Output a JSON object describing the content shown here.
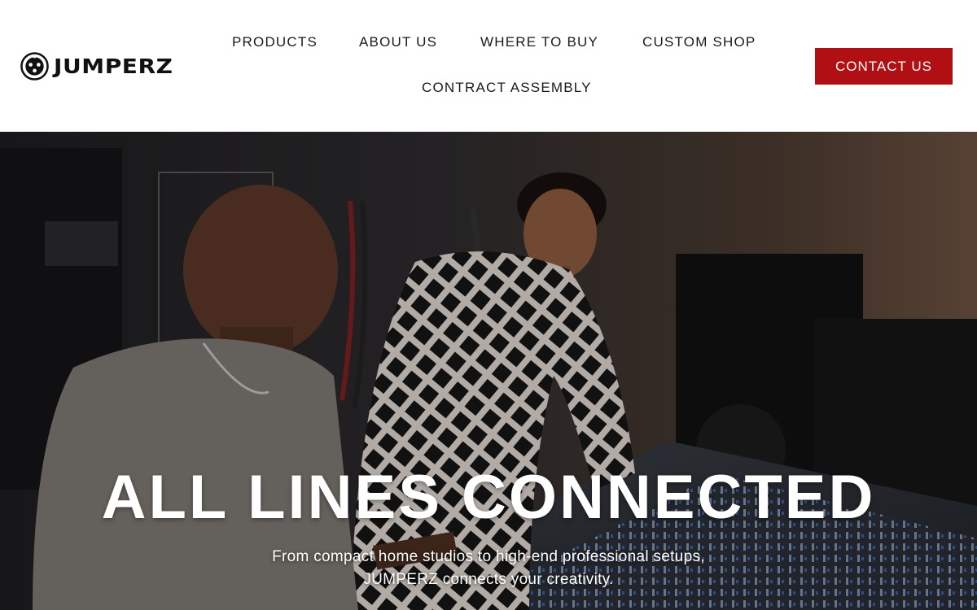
{
  "brand": {
    "name": "JUMPERZ",
    "logo_icon": "xlr-connector-icon"
  },
  "nav": {
    "items": [
      {
        "label": "PRODUCTS"
      },
      {
        "label": "ABOUT US"
      },
      {
        "label": "WHERE TO BUY"
      },
      {
        "label": "CUSTOM SHOP"
      },
      {
        "label": "CONTRACT ASSEMBLY"
      }
    ]
  },
  "header": {
    "cta_label": "CONTACT US",
    "cta_color": "#b00f13"
  },
  "hero": {
    "title": "ALL LINES CONNECTED",
    "subtitle_line1": "From compact home studios to high-end professional setups,",
    "subtitle_line2": "JUMPERZ connects your creativity.",
    "image_description_icon": "studio-photo"
  }
}
